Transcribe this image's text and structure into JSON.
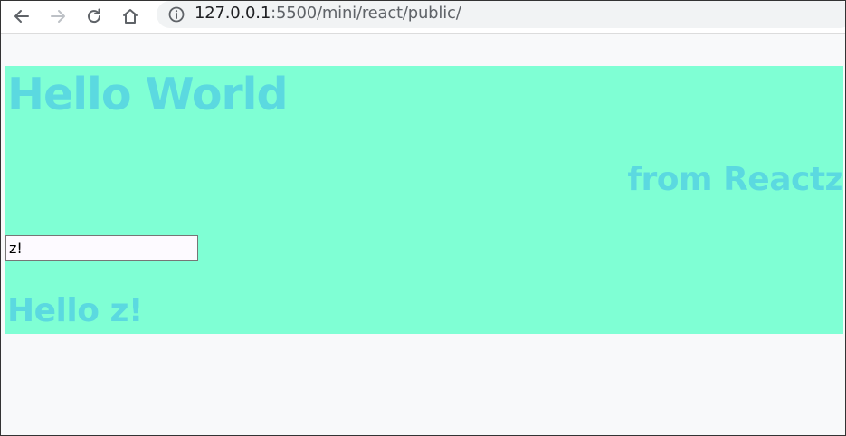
{
  "browser": {
    "url_host": "127.0.0.1",
    "url_rest": ":5500/mini/react/public/",
    "icons": {
      "back": "back-arrow-icon",
      "forward": "forward-arrow-icon",
      "reload": "reload-icon",
      "home": "home-icon",
      "info": "info-icon"
    }
  },
  "app": {
    "background": "#7fffd4",
    "text_color": "#5bd9e0",
    "heading": "Hello World",
    "subheading": "from Reactz",
    "input_value": "z!",
    "greeting": "Hello z!"
  }
}
